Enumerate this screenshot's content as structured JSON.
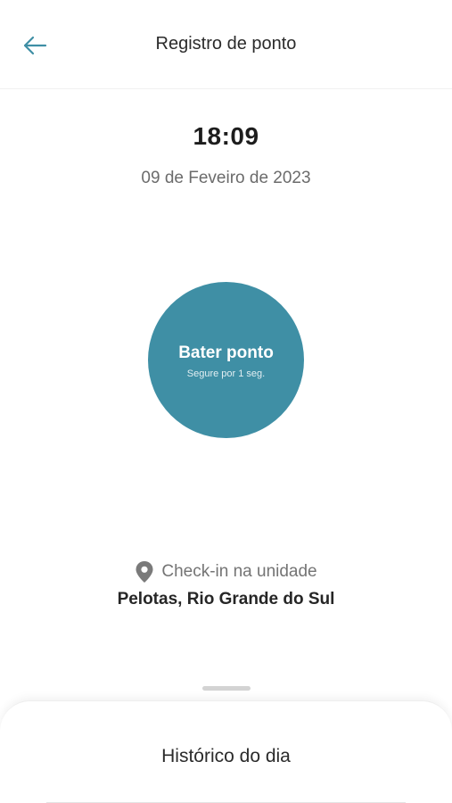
{
  "header": {
    "title": "Registro de ponto",
    "back_icon": "arrow-left-icon"
  },
  "clock": {
    "time": "18:09",
    "date": "09 de Feveiro de 2023"
  },
  "punch_button": {
    "label": "Bater ponto",
    "hint": "Segure por 1 seg.",
    "color": "#3f8fa5"
  },
  "location": {
    "icon": "location-pin-icon",
    "label": "Check-in na unidade",
    "name": "Pelotas, Rio Grande do Sul"
  },
  "history_sheet": {
    "title": "Histórico do dia"
  },
  "colors": {
    "accent": "#3f8fa5",
    "icon_gray": "#7a7a7a"
  }
}
